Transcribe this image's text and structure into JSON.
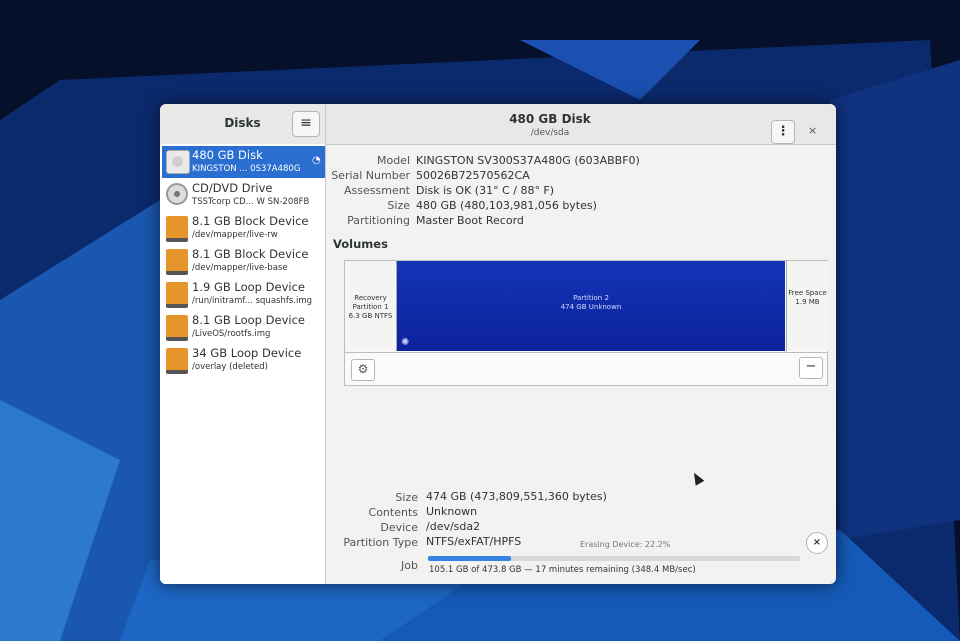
{
  "header": {
    "app_title": "Disks",
    "disk_title": "480 GB Disk",
    "disk_subtitle": "/dev/sda",
    "menu_icon": "≡",
    "kebab_icon": "⋮",
    "close_icon": "×"
  },
  "sidebar": {
    "items": [
      {
        "name": "480 GB Disk",
        "desc": "KINGSTON ... 0S37A480G",
        "icon": "hdd-icon"
      },
      {
        "name": "CD/DVD Drive",
        "desc": "TSSTcorp CD... W SN-208FB",
        "icon": "cd-icon"
      },
      {
        "name": "8.1 GB Block Device",
        "desc": "/dev/mapper/live-rw",
        "icon": "block-icon"
      },
      {
        "name": "8.1 GB Block Device",
        "desc": "/dev/mapper/live-base",
        "icon": "block-icon"
      },
      {
        "name": "1.9 GB Loop Device",
        "desc": "/run/initramf... squashfs.img",
        "icon": "block-icon"
      },
      {
        "name": "8.1 GB Loop Device",
        "desc": "/LiveOS/rootfs.img",
        "icon": "block-icon"
      },
      {
        "name": "34 GB Loop Device",
        "desc": "/overlay (deleted)",
        "icon": "block-icon"
      }
    ]
  },
  "disk_info": {
    "model_label": "Model",
    "model": "KINGSTON SV300S37A480G (603ABBF0)",
    "serial_label": "Serial Number",
    "serial": "50026B72570562CA",
    "assessment_label": "Assessment",
    "assessment": "Disk is OK (31° C / 88° F)",
    "size_label": "Size",
    "size": "480 GB (480,103,981,056 bytes)",
    "partitioning_label": "Partitioning",
    "partitioning": "Master Boot Record"
  },
  "volumes": {
    "title": "Volumes",
    "partitions": [
      {
        "line1": "Recovery",
        "line2": "Partition 1",
        "line3": "6.3 GB NTFS"
      },
      {
        "line1": "Partition 2",
        "line2": "474 GB Unknown"
      },
      {
        "line1": "Free Space",
        "line2": "1.9 MB"
      }
    ],
    "gear_icon": "⚙",
    "minus_icon": "−"
  },
  "partition_info": {
    "size_label": "Size",
    "size": "474 GB (473,809,551,360 bytes)",
    "contents_label": "Contents",
    "contents": "Unknown",
    "device_label": "Device",
    "device": "/dev/sda2",
    "type_label": "Partition Type",
    "type": "NTFS/exFAT/HPFS",
    "job_label": "Job"
  },
  "job": {
    "status": "Erasing Device: 22.2%",
    "progress_fraction": 0.222,
    "detail": "105.1 GB of 473.8 GB — 17 minutes remaining (348.4 MB/sec)",
    "cancel_icon": "×"
  },
  "colors": {
    "selection": "#2a6fd0",
    "partition_fill": "#1434b8",
    "progress": "#3584e4"
  }
}
